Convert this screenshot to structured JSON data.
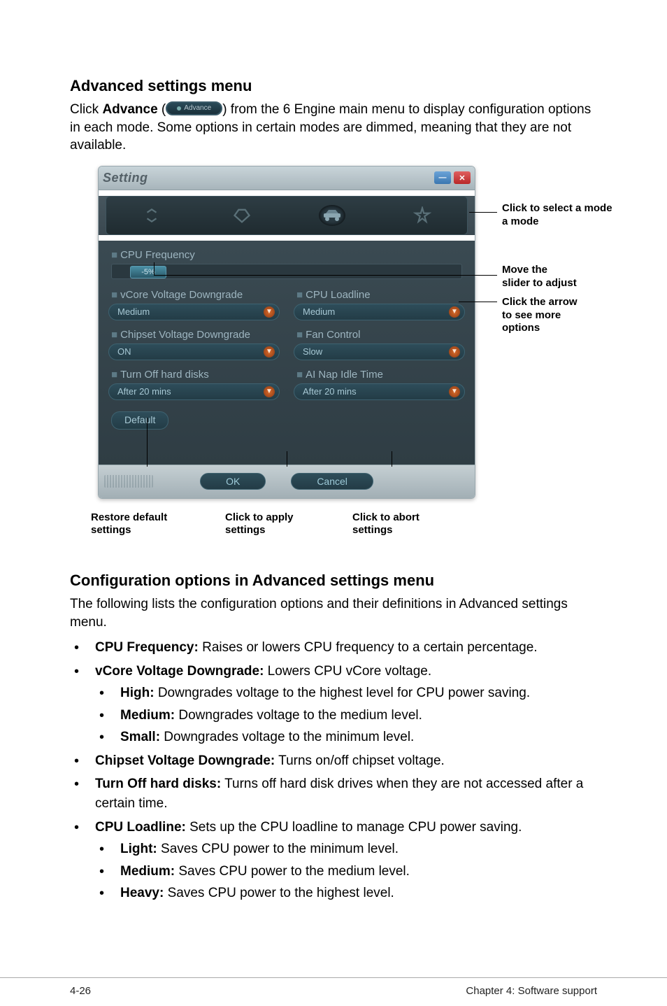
{
  "headings": {
    "advanced": "Advanced settings menu",
    "config": "Configuration options in Advanced settings menu"
  },
  "intro": {
    "p1a": "Click ",
    "advance_bold": "Advance",
    "p1b": " (",
    "advance_btn": "Advance",
    "p1c": ") from the 6 Engine main menu to display configuration options in each mode. Some options in certain modes are dimmed, meaning that they are not available."
  },
  "shot": {
    "title": "Setting",
    "labels": {
      "cpu_freq": "CPU Frequency",
      "vcore": "vCore Voltage Downgrade",
      "cpu_loadline": "CPU Loadline",
      "chipset": "Chipset Voltage Downgrade",
      "fan": "Fan Control",
      "turn_off": "Turn Off hard disks",
      "ai_nap": "AI Nap Idle Time"
    },
    "values": {
      "slider": "-5%",
      "vcore": "Medium",
      "cpu_loadline": "Medium",
      "chipset": "ON",
      "fan": "Slow",
      "turn_off": "After 20 mins",
      "ai_nap": "After 20 mins",
      "default_btn": "Default",
      "ok": "OK",
      "cancel": "Cancel"
    }
  },
  "callouts": {
    "mode": "Click to select a mode",
    "move1": "Move the",
    "move2": "slider to adjust",
    "arrow1": "Click the arrow",
    "arrow2": "to see more",
    "arrow3": "options",
    "restore1": "Restore default",
    "restore2": "settings",
    "apply1": "Click to apply",
    "apply2": "settings",
    "abort1": "Click to abort",
    "abort2": "settings"
  },
  "config_intro": "The following lists the configuration options and their definitions in Advanced settings menu.",
  "options": {
    "cpu_freq_b": "CPU Frequency:",
    "cpu_freq_t": " Raises or lowers CPU frequency to a certain percentage.",
    "vcore_b": "vCore Voltage Downgrade:",
    "vcore_t": " Lowers CPU vCore voltage.",
    "vcore_high_b": "High:",
    "vcore_high_t": " Downgrades voltage to the highest level for CPU power saving.",
    "vcore_med_b": "Medium:",
    "vcore_med_t": " Downgrades voltage to the medium level.",
    "vcore_small_b": "Small:",
    "vcore_small_t": " Downgrades voltage to the minimum level.",
    "chipset_b": "Chipset Voltage Downgrade:",
    "chipset_t": " Turns on/off chipset voltage.",
    "turnoff_b": "Turn Off hard disks:",
    "turnoff_t": " Turns off hard disk drives when they are not accessed after a certain time.",
    "loadline_b": "CPU Loadline:",
    "loadline_t": " Sets up the CPU loadline to manage CPU power saving.",
    "ll_light_b": "Light:",
    "ll_light_t": " Saves CPU power to the minimum level.",
    "ll_med_b": "Medium:",
    "ll_med_t": " Saves CPU power to the medium level.",
    "ll_heavy_b": "Heavy:",
    "ll_heavy_t": " Saves CPU power to the highest level."
  },
  "footer": {
    "left": "4-26",
    "right": "Chapter 4: Software support"
  }
}
